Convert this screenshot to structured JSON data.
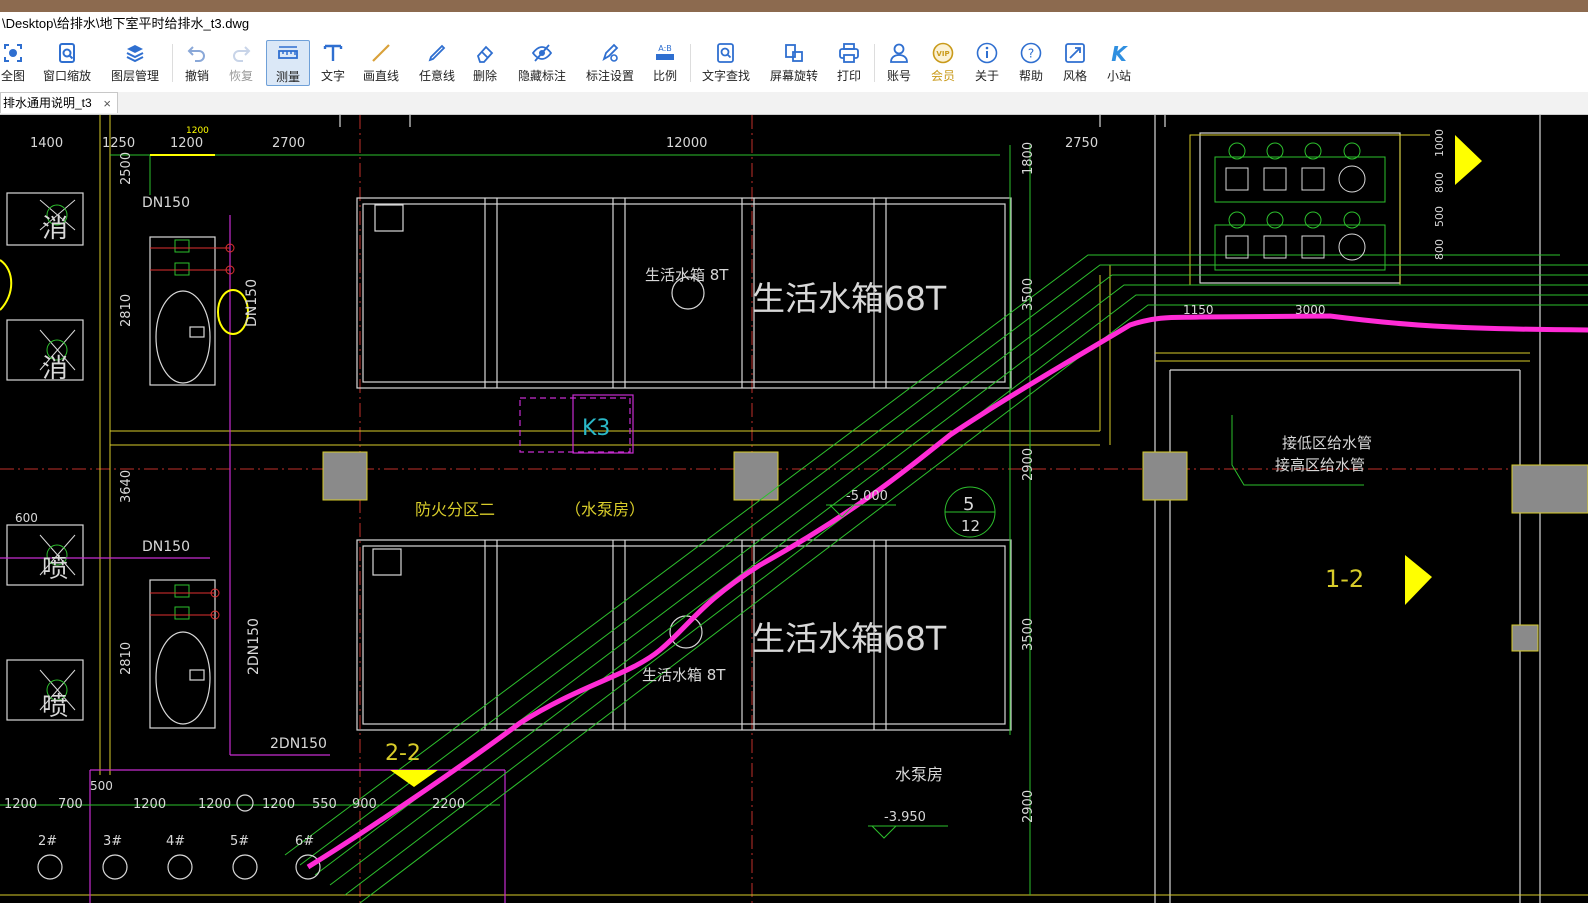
{
  "title_bar": {
    "path": "\\Desktop\\给排水\\地下室平时给排水_t3.dwg"
  },
  "toolbar": {
    "items": [
      {
        "label": "全图",
        "icon": "fit-all-icon"
      },
      {
        "label": "窗口缩放",
        "icon": "window-zoom-icon"
      },
      {
        "label": "图层管理",
        "icon": "layers-icon"
      },
      {
        "label": "撤销",
        "icon": "undo-icon"
      },
      {
        "label": "恢复",
        "icon": "redo-icon"
      },
      {
        "label": "测量",
        "icon": "measure-icon"
      },
      {
        "label": "文字",
        "icon": "text-icon"
      },
      {
        "label": "画直线",
        "icon": "line-icon"
      },
      {
        "label": "任意线",
        "icon": "freehand-icon"
      },
      {
        "label": "删除",
        "icon": "eraser-icon"
      },
      {
        "label": "隐藏标注",
        "icon": "hide-annotation-icon"
      },
      {
        "label": "标注设置",
        "icon": "annotation-settings-icon"
      },
      {
        "label": "比例",
        "icon": "scale-icon"
      },
      {
        "label": "文字查找",
        "icon": "text-search-icon"
      },
      {
        "label": "屏幕旋转",
        "icon": "rotate-screen-icon"
      },
      {
        "label": "打印",
        "icon": "print-icon"
      },
      {
        "label": "账号",
        "icon": "account-icon"
      },
      {
        "label": "会员",
        "icon": "vip-icon"
      },
      {
        "label": "关于",
        "icon": "info-icon"
      },
      {
        "label": "帮助",
        "icon": "help-icon"
      },
      {
        "label": "风格",
        "icon": "style-icon"
      },
      {
        "label": "小站",
        "icon": "site-icon"
      }
    ],
    "active": "测量"
  },
  "tabs": [
    {
      "label": "排水通用说明_t3",
      "close": "×"
    }
  ],
  "colors": {
    "cad_background": "#000000",
    "highlight_pipe": "#ff2bd6",
    "accent": "#2f6fd0",
    "vip": "#c99a1a"
  },
  "drawing": {
    "dimensions_top": [
      "1400",
      "1250",
      "1200",
      "1200",
      "2700",
      "12000",
      "2750"
    ],
    "dimensions_left": [
      "2500",
      "2810",
      "3640",
      "2810"
    ],
    "dimensions_right": [
      "1800",
      "3500",
      "2900",
      "3500",
      "2900"
    ],
    "dimensions_far_right": [
      "1000",
      "800",
      "500",
      "800"
    ],
    "dimensions_bottom": [
      "1200",
      "700",
      "1200",
      "1200",
      "1200",
      "550",
      "900",
      "2200"
    ],
    "pipe_dims": [
      "1150",
      "3000"
    ],
    "misc_dims": [
      "600",
      "500"
    ],
    "pipe_labels": [
      "DN150",
      "DN150",
      "DN150",
      "2DN150",
      "2DN150"
    ],
    "tank_labels": [
      "生活水箱 8T",
      "生活水箱 8T",
      "生活水箱68T",
      "生活水箱68T"
    ],
    "room_labels": [
      "防火分区二",
      "（水泵房）",
      "水泵房"
    ],
    "elevations": [
      "-5.000",
      "-3.950"
    ],
    "section_marks": [
      "2-2",
      "1-2"
    ],
    "detail_mark": {
      "top": "5",
      "bottom": "12"
    },
    "k_label": "K3",
    "pump_labels": [
      "2#",
      "3#",
      "4#",
      "5#",
      "6#"
    ],
    "notes": [
      "接低区给水管",
      "接高区给水管"
    ],
    "equipment_glyphs": [
      "消",
      "消",
      "喷",
      "喷"
    ]
  }
}
